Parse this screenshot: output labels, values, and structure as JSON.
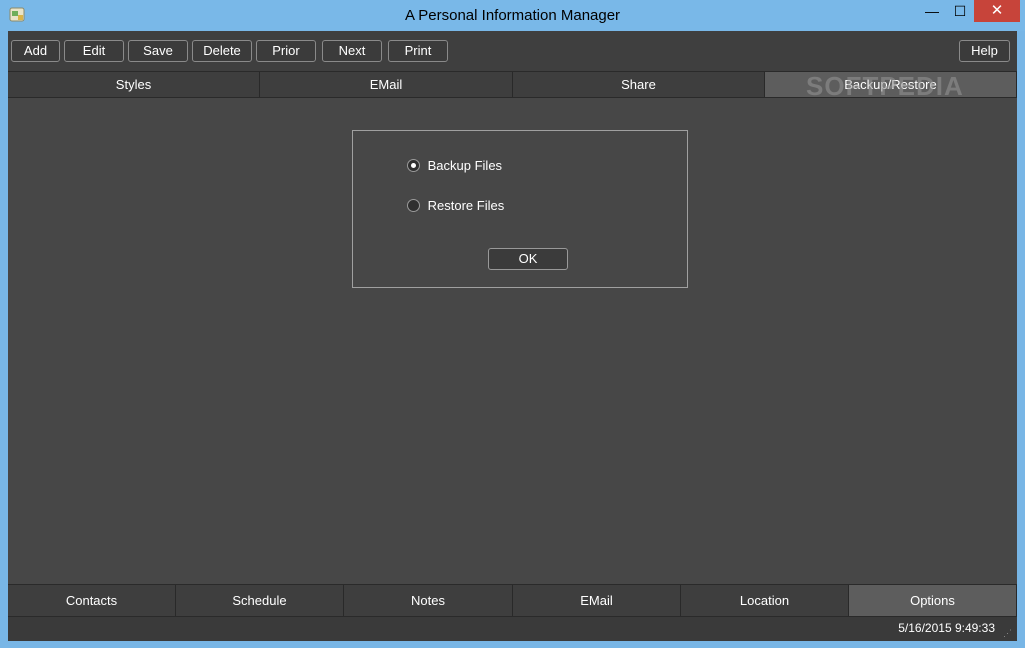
{
  "window": {
    "title": "A Personal Information Manager",
    "minimize_glyph": "—",
    "maximize_glyph": "☐",
    "close_glyph": "✕"
  },
  "toolbar": {
    "add_label": "Add",
    "edit_label": "Edit",
    "save_label": "Save",
    "delete_label": "Delete",
    "prior_label": "Prior",
    "next_label": "Next",
    "print_label": "Print",
    "help_label": "Help"
  },
  "top_tabs": [
    {
      "label": "Styles"
    },
    {
      "label": "EMail"
    },
    {
      "label": "Share"
    },
    {
      "label": "Backup/Restore",
      "active": true
    }
  ],
  "watermark": "SOFTPEDIA",
  "dialog": {
    "backup_label": "Backup Files",
    "restore_label": "Restore Files",
    "selected": "backup",
    "ok_label": "OK"
  },
  "bottom_tabs": [
    {
      "label": "Contacts"
    },
    {
      "label": "Schedule"
    },
    {
      "label": "Notes"
    },
    {
      "label": "EMail"
    },
    {
      "label": "Location"
    },
    {
      "label": "Options",
      "active": true
    }
  ],
  "status": {
    "datetime": "5/16/2015 9:49:33"
  },
  "colors": {
    "title_bar": "#79b8e8",
    "background": "#474747",
    "active_tab": "#5d5d5d",
    "close_button": "#c7443a"
  }
}
